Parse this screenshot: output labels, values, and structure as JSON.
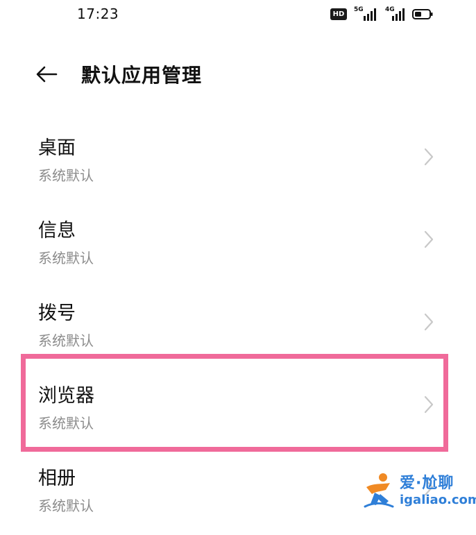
{
  "status_bar": {
    "time": "17:23",
    "hd_label": "HD",
    "network_1": "5G",
    "network_2": "4G"
  },
  "header": {
    "title": "默认应用管理",
    "back_icon": "arrow-left-icon"
  },
  "items": [
    {
      "title": "桌面",
      "subtitle": "系统默认"
    },
    {
      "title": "信息",
      "subtitle": "系统默认"
    },
    {
      "title": "拨号",
      "subtitle": "系统默认"
    },
    {
      "title": "浏览器",
      "subtitle": "系统默认",
      "highlighted": true
    },
    {
      "title": "相册",
      "subtitle": "系统默认"
    }
  ],
  "highlight_color": "#f06a9a",
  "watermark": {
    "brand": "爱·尬聊",
    "url": "igaliao.com",
    "color": "#2f7fd8"
  }
}
